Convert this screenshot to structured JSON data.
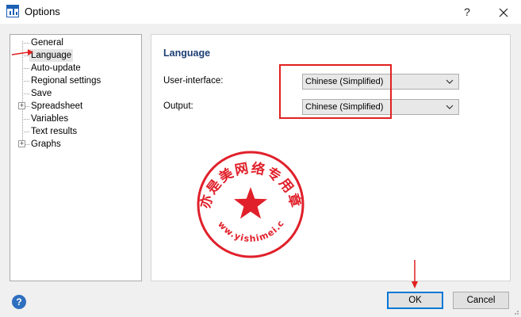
{
  "window": {
    "title": "Options",
    "help_glyph": "?",
    "close_glyph": "✕"
  },
  "tree": {
    "items": [
      {
        "label": "General",
        "expandable": false
      },
      {
        "label": "Language",
        "expandable": false,
        "selected": true
      },
      {
        "label": "Auto-update",
        "expandable": false
      },
      {
        "label": "Regional settings",
        "expandable": false
      },
      {
        "label": "Save",
        "expandable": false
      },
      {
        "label": "Spreadsheet",
        "expandable": true
      },
      {
        "label": "Variables",
        "expandable": false
      },
      {
        "label": "Text results",
        "expandable": false
      },
      {
        "label": "Graphs",
        "expandable": true
      }
    ],
    "expander_glyph": "+"
  },
  "content": {
    "section_title": "Language",
    "ui_label": "User-interface:",
    "ui_value": "Chinese (Simplified)",
    "output_label": "Output:",
    "output_value": "Chinese (Simplified)"
  },
  "stamp": {
    "arc_text": "亦是美网络专用章",
    "bottom_text": "www.yishimei.cn",
    "color": "#e0202a"
  },
  "footer": {
    "help_glyph": "?",
    "ok_label": "OK",
    "cancel_label": "Cancel"
  },
  "colors": {
    "annotation_red": "#e02020",
    "section_title": "#1c3f73",
    "ok_border": "#0078d7"
  }
}
